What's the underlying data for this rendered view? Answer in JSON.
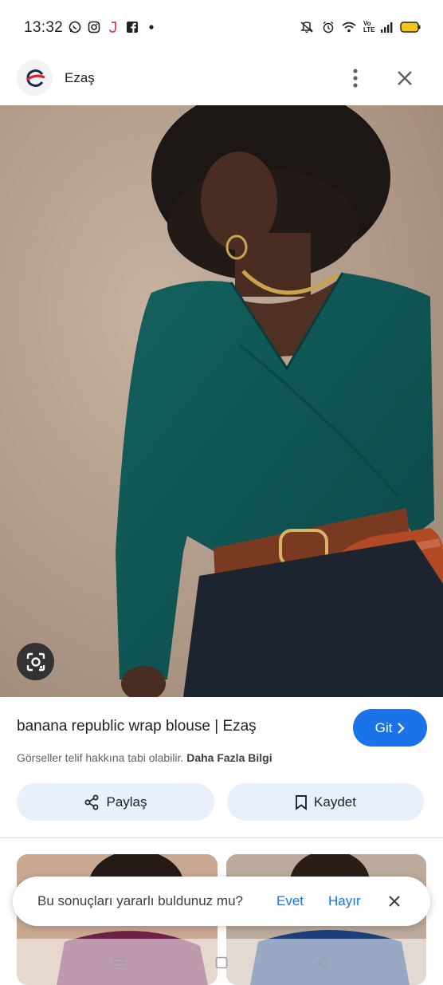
{
  "status_bar": {
    "time": "13:32",
    "left_icons": [
      "whatsapp-icon",
      "instagram-icon",
      "app-j-icon",
      "facebook-icon",
      "dot-icon"
    ],
    "right_icons": [
      "mute-icon",
      "alarm-icon",
      "wifi-icon",
      "volte-icon",
      "signal-icon",
      "battery-icon"
    ],
    "volte_label": "Vo LTE",
    "battery_color": "#f5c518"
  },
  "header": {
    "site_name": "Ezaş",
    "logo_icon": "ezas-logo",
    "more_icon": "more-vert-icon",
    "close_icon": "close-icon"
  },
  "main_image": {
    "description_icon": "photo",
    "lens_icon": "google-lens-icon"
  },
  "result": {
    "title": "banana republic wrap blouse | Ezaş",
    "go_label": "Git",
    "copyright_text": "Görseller telif hakkına tabi olabilir.",
    "learn_more": "Daha Fazla Bilgi",
    "share_label": "Paylaş",
    "save_label": "Kaydet"
  },
  "feedback": {
    "question": "Bu sonuçları yararlı buldunuz mu?",
    "yes": "Evet",
    "no": "Hayır"
  },
  "nav": {
    "icons": [
      "recents-icon",
      "home-icon",
      "back-icon"
    ]
  },
  "colors": {
    "accent": "#1a73e8",
    "chip_bg": "#e8f0fe"
  }
}
